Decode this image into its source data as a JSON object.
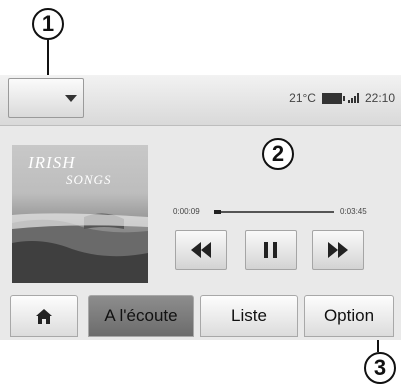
{
  "callouts": {
    "c1": "1",
    "c2": "2",
    "c3": "3"
  },
  "status_bar": {
    "temperature": "21°C",
    "clock": "22:10"
  },
  "album": {
    "title_line1": "IRISH",
    "title_line2": "SONGS"
  },
  "progress": {
    "elapsed": "0:00:09",
    "total": "0:03:45",
    "fraction": 0.06
  },
  "tabs": {
    "listening": "A l'écoute",
    "list": "Liste",
    "option": "Option"
  },
  "icons": {
    "dropdown": "chevron-down-icon",
    "battery": "battery-icon",
    "signal": "signal-icon",
    "prev": "rewind-icon",
    "pause": "pause-icon",
    "next": "fast-forward-icon",
    "home": "home-icon"
  }
}
